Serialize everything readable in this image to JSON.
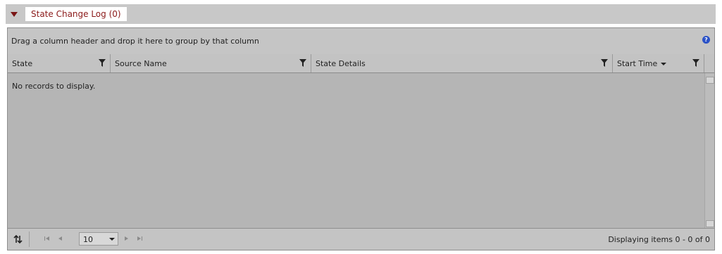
{
  "panel": {
    "title": "State Change Log (0)"
  },
  "grid": {
    "group_hint": "Drag a column header and drop it here to group by that column",
    "columns": [
      {
        "label": "State"
      },
      {
        "label": "Source Name"
      },
      {
        "label": "State Details"
      },
      {
        "label": "Start Time"
      }
    ],
    "empty_message": "No records to display.",
    "help_icon": "?"
  },
  "pager": {
    "page_size": "10",
    "info": "Displaying items 0 - 0 of 0"
  },
  "colors": {
    "title": "#8b1a1a",
    "help": "#2b52c7"
  }
}
